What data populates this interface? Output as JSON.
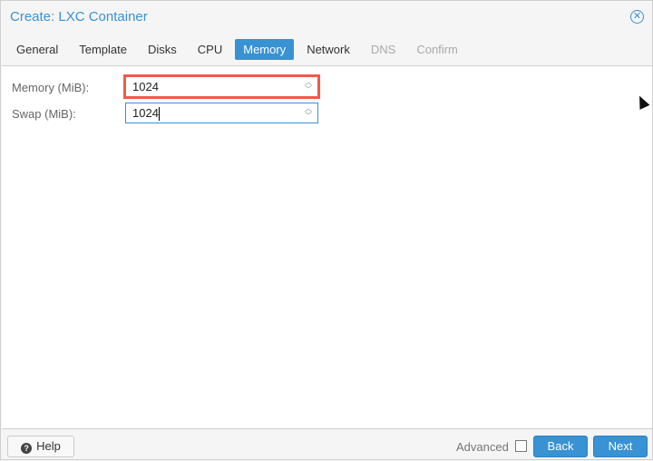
{
  "window": {
    "title": "Create: LXC Container",
    "close_icon": "circle-x-icon"
  },
  "tabs": [
    {
      "label": "General",
      "state": "normal"
    },
    {
      "label": "Template",
      "state": "normal"
    },
    {
      "label": "Disks",
      "state": "normal"
    },
    {
      "label": "CPU",
      "state": "normal"
    },
    {
      "label": "Memory",
      "state": "active"
    },
    {
      "label": "Network",
      "state": "normal"
    },
    {
      "label": "DNS",
      "state": "disabled"
    },
    {
      "label": "Confirm",
      "state": "disabled"
    }
  ],
  "form": {
    "memory_label": "Memory (MiB):",
    "memory_value": "1024",
    "swap_label": "Swap (MiB):",
    "swap_value": "1024"
  },
  "footer": {
    "help": "Help",
    "advanced": "Advanced",
    "back": "Back",
    "next": "Next"
  },
  "colors": {
    "accent": "#3892d4",
    "highlight": "#f05a4a"
  }
}
